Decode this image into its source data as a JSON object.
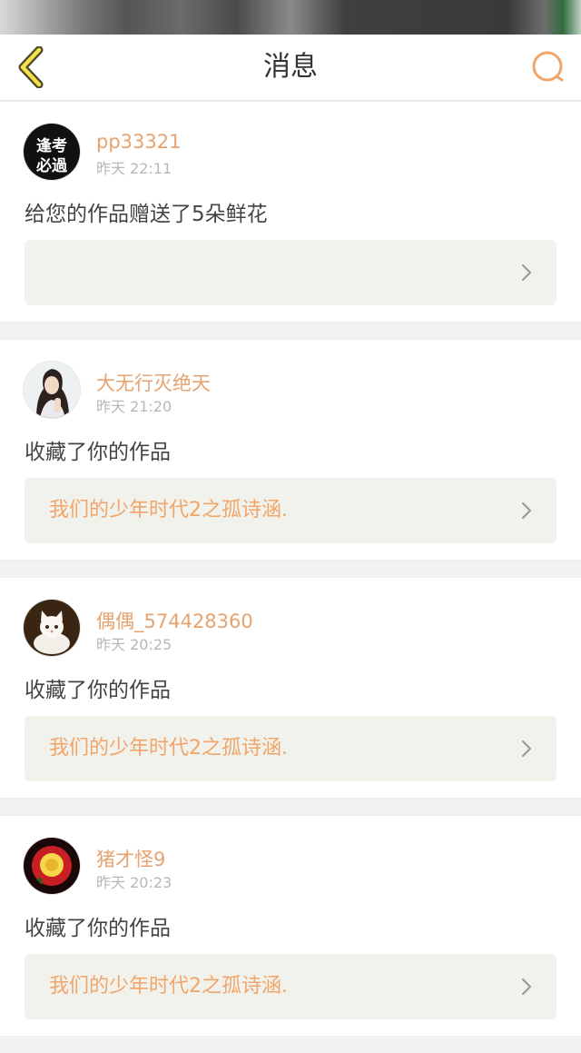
{
  "header": {
    "title": "消息",
    "back_icon": "chevron-left-icon",
    "search_icon": "search-icon",
    "accent_color": "#f0a56a"
  },
  "messages": [
    {
      "username": "pp33321",
      "time": "昨天  22:11",
      "action": "给您的作品赠送了5朵鲜花",
      "work_title": "",
      "avatar": "text-logo-avatar",
      "avatar_text": "逢考必過"
    },
    {
      "username": "大无行灭绝天",
      "time": "昨天  21:20",
      "action": "收藏了你的作品",
      "work_title": "我们的少年时代2之孤诗涵.",
      "avatar": "girl-photo-avatar"
    },
    {
      "username": "偶偶_574428360",
      "time": "昨天  20:25",
      "action": "收藏了你的作品",
      "work_title": "我们的少年时代2之孤诗涵.",
      "avatar": "kitten-photo-avatar"
    },
    {
      "username": "猪才怪9",
      "time": "昨天  20:23",
      "action": "收藏了你的作品",
      "work_title": "我们的少年时代2之孤诗涵.",
      "avatar": "rose-photo-avatar"
    }
  ]
}
